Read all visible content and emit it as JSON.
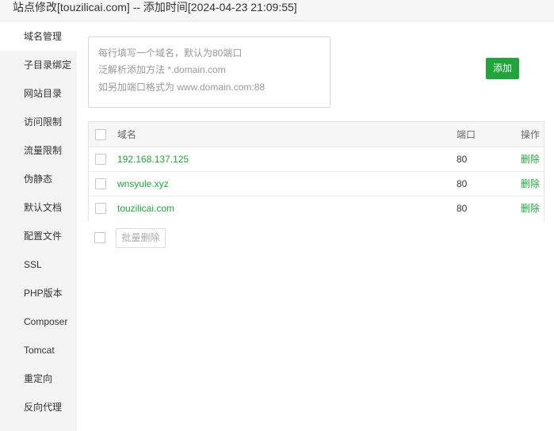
{
  "window": {
    "title": "站点修改[touzilicai.com] -- 添加时间[2024-04-23 21:09:55]"
  },
  "sidebar": {
    "items": [
      {
        "label": "域名管理",
        "active": true
      },
      {
        "label": "子目录绑定"
      },
      {
        "label": "网站目录"
      },
      {
        "label": "访问限制"
      },
      {
        "label": "流量限制"
      },
      {
        "label": "伪静态"
      },
      {
        "label": "默认文档"
      },
      {
        "label": "配置文件"
      },
      {
        "label": "SSL"
      },
      {
        "label": "PHP版本"
      },
      {
        "label": "Composer"
      },
      {
        "label": "Tomcat"
      },
      {
        "label": "重定向"
      },
      {
        "label": "反向代理"
      }
    ]
  },
  "domain_input": {
    "placeholder_lines": [
      "每行填写一个域名，默认为80端口",
      "泛解析添加方法 *.domain.com",
      "如另加端口格式为 www.domain.com:88"
    ]
  },
  "add_button": {
    "label": "添加"
  },
  "table": {
    "headers": {
      "name": "域名",
      "port": "端口",
      "operation": "操作"
    },
    "rows": [
      {
        "domain": "192.168.137.125",
        "port": "80",
        "action": "删除"
      },
      {
        "domain": "wnsyule.xyz",
        "port": "80",
        "action": "删除"
      },
      {
        "domain": "touzilicai.com",
        "port": "80",
        "action": "删除"
      }
    ]
  },
  "batch": {
    "delete_label": "批量删除"
  },
  "colors": {
    "accent": "#20a53a",
    "sidebar_bg": "#f3f3f3"
  }
}
